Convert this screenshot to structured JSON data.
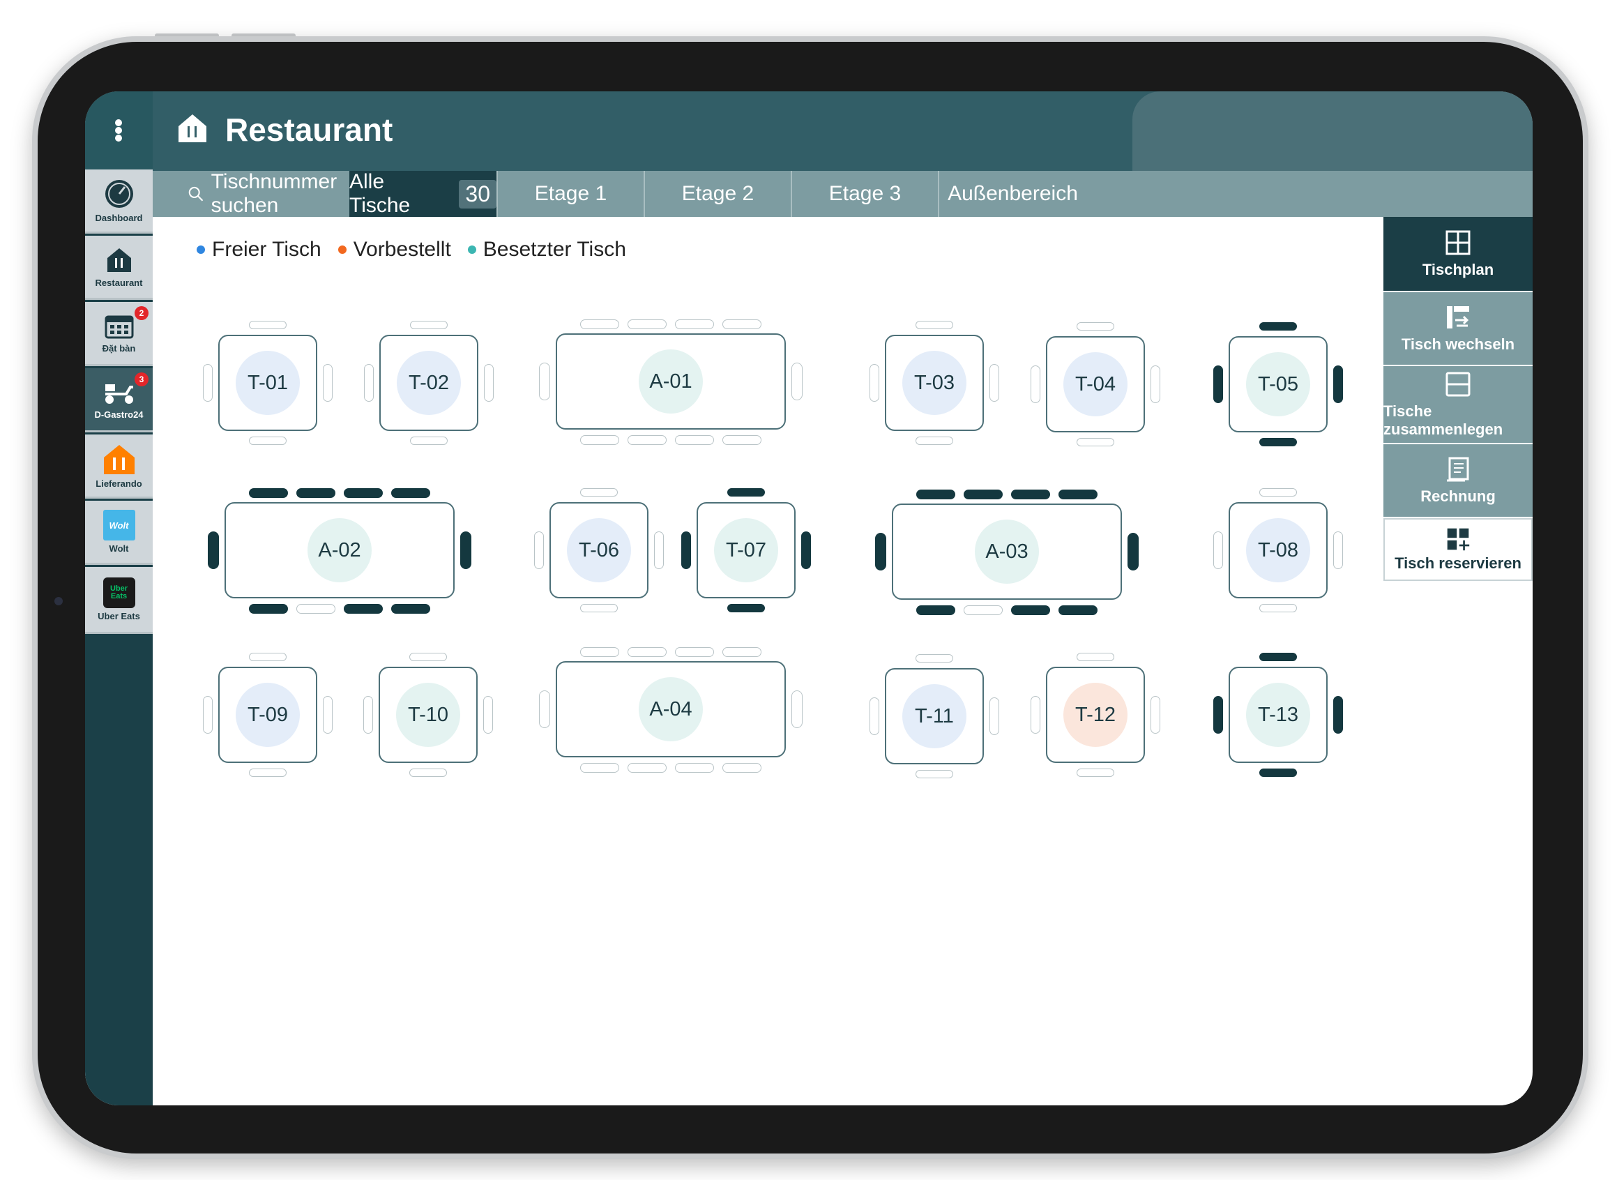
{
  "header": {
    "title": "Restaurant"
  },
  "sidebar": {
    "items": [
      {
        "label": "Dashboard",
        "icon": "gauge-icon"
      },
      {
        "label": "Restaurant",
        "icon": "restaurant-icon"
      },
      {
        "label": "Đặt bàn",
        "icon": "calendar-icon",
        "badge": "2"
      },
      {
        "label": "D-Gastro24",
        "icon": "scooter-icon",
        "badge": "3"
      },
      {
        "label": "Lieferando",
        "icon": "lieferando-icon"
      },
      {
        "label": "Wolt",
        "icon": "wolt-logo",
        "logo_text": "Wolt"
      },
      {
        "label": "Uber Eats",
        "icon": "ubereats-logo",
        "logo_text": "Uber Eats"
      }
    ]
  },
  "tabs": {
    "search_label": "Tischnummer suchen",
    "all_label": "Alle Tische",
    "all_count": "30",
    "floors": [
      "Etage 1",
      "Etage 2",
      "Etage 3",
      "Außenbereich"
    ]
  },
  "legend": [
    {
      "label": "Freier Tisch",
      "color": "#2f86e0"
    },
    {
      "label": "Vorbestellt",
      "color": "#f2681f"
    },
    {
      "label": "Besetzter Tisch",
      "color": "#3cb6b2"
    }
  ],
  "actions": [
    {
      "label": "Tischplan",
      "icon": "grid-icon"
    },
    {
      "label": "Tisch wechseln",
      "icon": "swap-table-icon"
    },
    {
      "label": "Tische zusammenlegen",
      "icon": "merge-icon"
    },
    {
      "label": "Rechnung",
      "icon": "receipt-icon"
    },
    {
      "label": "Tisch reservieren",
      "icon": "reserve-icon"
    }
  ],
  "status_colors": {
    "free": "#e4edf9",
    "reserved": "#fbe6dc",
    "occupied": "#e4f3f1"
  },
  "tables": [
    {
      "id": "T-01",
      "status": "free"
    },
    {
      "id": "T-02",
      "status": "free"
    },
    {
      "id": "A-01",
      "status": "occupied"
    },
    {
      "id": "T-03",
      "status": "free"
    },
    {
      "id": "T-04",
      "status": "free"
    },
    {
      "id": "T-05",
      "status": "occupied"
    },
    {
      "id": "A-02",
      "status": "occupied"
    },
    {
      "id": "T-06",
      "status": "free"
    },
    {
      "id": "T-07",
      "status": "occupied"
    },
    {
      "id": "A-03",
      "status": "occupied"
    },
    {
      "id": "T-08",
      "status": "free"
    },
    {
      "id": "T-09",
      "status": "free"
    },
    {
      "id": "T-10",
      "status": "occupied"
    },
    {
      "id": "A-04",
      "status": "occupied"
    },
    {
      "id": "T-11",
      "status": "free"
    },
    {
      "id": "T-12",
      "status": "reserved"
    },
    {
      "id": "T-13",
      "status": "occupied"
    }
  ]
}
